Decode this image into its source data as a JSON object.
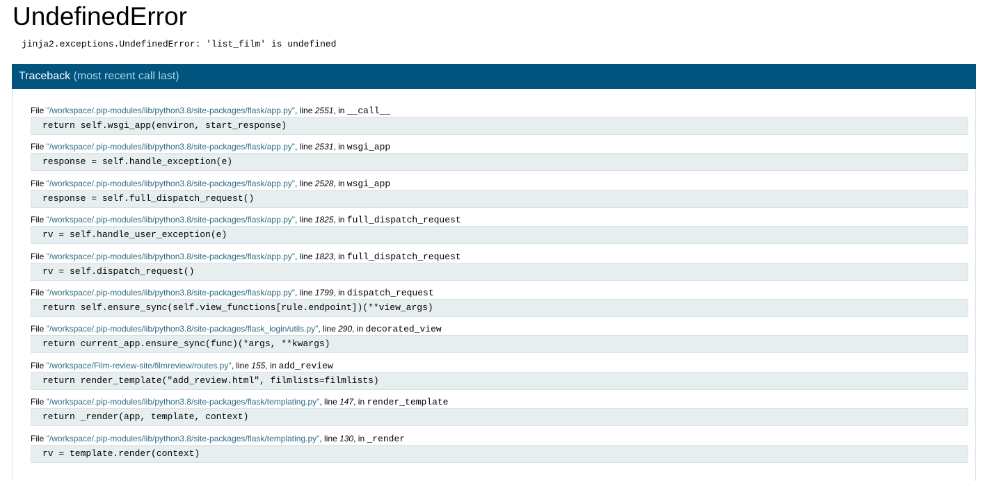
{
  "page": {
    "title": "UndefinedError",
    "error_message": "jinja2.exceptions.UndefinedError: 'list_film' is undefined"
  },
  "traceback": {
    "title": "Traceback",
    "hint": "(most recent call last)",
    "file_prefix": "File ",
    "line_prefix": ", line ",
    "in_prefix": ", in ",
    "frames": [
      {
        "file": "\"/workspace/.pip-modules/lib/python3.8/site-packages/flask/app.py\"",
        "line": "2551",
        "func": "__call__",
        "code": "return self.wsgi_app(environ, start_response)"
      },
      {
        "file": "\"/workspace/.pip-modules/lib/python3.8/site-packages/flask/app.py\"",
        "line": "2531",
        "func": "wsgi_app",
        "code": "response = self.handle_exception(e)"
      },
      {
        "file": "\"/workspace/.pip-modules/lib/python3.8/site-packages/flask/app.py\"",
        "line": "2528",
        "func": "wsgi_app",
        "code": "response = self.full_dispatch_request()"
      },
      {
        "file": "\"/workspace/.pip-modules/lib/python3.8/site-packages/flask/app.py\"",
        "line": "1825",
        "func": "full_dispatch_request",
        "code": "rv = self.handle_user_exception(e)"
      },
      {
        "file": "\"/workspace/.pip-modules/lib/python3.8/site-packages/flask/app.py\"",
        "line": "1823",
        "func": "full_dispatch_request",
        "code": "rv = self.dispatch_request()"
      },
      {
        "file": "\"/workspace/.pip-modules/lib/python3.8/site-packages/flask/app.py\"",
        "line": "1799",
        "func": "dispatch_request",
        "code": "return self.ensure_sync(self.view_functions[rule.endpoint])(**view_args)"
      },
      {
        "file": "\"/workspace/.pip-modules/lib/python3.8/site-packages/flask_login/utils.py\"",
        "line": "290",
        "func": "decorated_view",
        "code": "return current_app.ensure_sync(func)(*args, **kwargs)"
      },
      {
        "file": "\"/workspace/Film-review-site/filmreview/routes.py\"",
        "line": "155",
        "func": "add_review",
        "code": "return render_template(\"add_review.html\", filmlists=filmlists)"
      },
      {
        "file": "\"/workspace/.pip-modules/lib/python3.8/site-packages/flask/templating.py\"",
        "line": "147",
        "func": "render_template",
        "code": "return _render(app, template, context)"
      },
      {
        "file": "\"/workspace/.pip-modules/lib/python3.8/site-packages/flask/templating.py\"",
        "line": "130",
        "func": "_render",
        "code": "rv = template.render(context)"
      }
    ]
  },
  "colors": {
    "header_bg": "#00547e",
    "header_hint": "#a8d6ec",
    "filename": "#2d6b80",
    "code_bg": "#e7eef0"
  }
}
